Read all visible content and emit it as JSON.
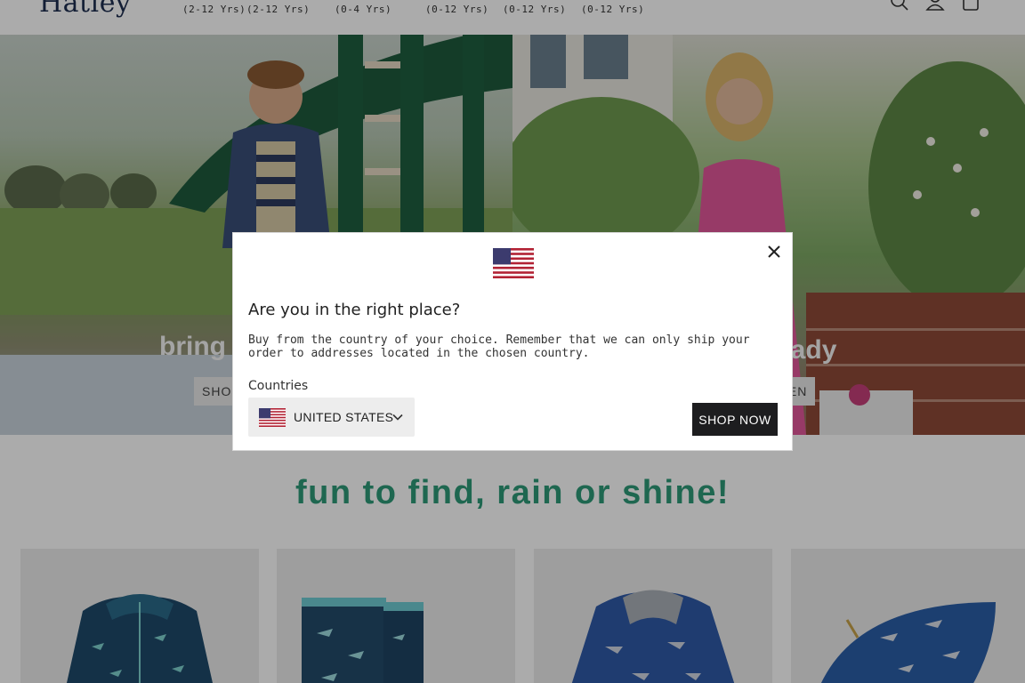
{
  "header": {
    "logo": "Hatley",
    "nav_age_labels": [
      "(2-12 Yrs)",
      "(2-12 Yrs)",
      "(0-4 Yrs)",
      "(0-12 Yrs)",
      "(0-12 Yrs)",
      "(0-12 Yrs)"
    ],
    "icons": [
      "search-icon",
      "account-icon",
      "cart-icon"
    ]
  },
  "hero": {
    "left_text_visible": "bring",
    "left_button_visible": "SHOP",
    "right_text_visible": "eady",
    "right_button_visible": "IEN"
  },
  "modal": {
    "title": "Are you in the right place?",
    "message": "Buy from the country of your choice. Remember that we can only ship your order to addresses located in the chosen country.",
    "countries_label": "Countries",
    "selected_country": "UNITED STATES",
    "shop_now_label": "SHOP NOW",
    "icons": [
      "us-flag-icon",
      "close-icon",
      "chevron-down-icon"
    ]
  },
  "section": {
    "tagline": "fun to find, rain or shine!"
  },
  "colors": {
    "brand_navy": "#1d2e4f",
    "tagline_green": "#2e9a78",
    "button_dark": "#1d1d1f"
  }
}
